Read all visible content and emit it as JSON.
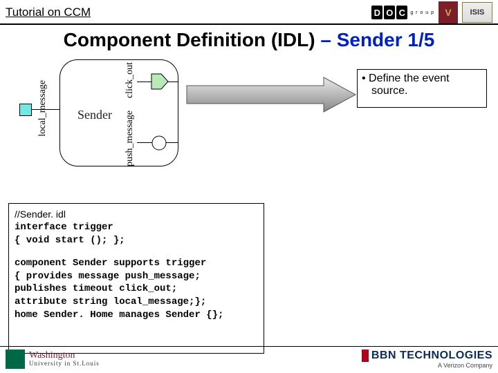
{
  "header": {
    "left": "Tutorial on CCM",
    "logo_d": "D",
    "logo_o": "O",
    "logo_c": "C",
    "logo_sub": "g r o u p",
    "isis": "ISIS"
  },
  "title": {
    "prefix": "Component Definition (IDL)",
    "suffix": " – Sender 1/5"
  },
  "diagram": {
    "component": "Sender",
    "local_message": "local_message",
    "click_out": "click_out",
    "push_message": "push_message"
  },
  "bullets": {
    "line1": "• Define the event",
    "line2": "  source."
  },
  "code": {
    "l1": "//Sender. idl",
    "l2": "interface trigger",
    "l3": "{ void start (); };",
    "l4": "component Sender supports trigger",
    "l5": "{ provides message push_message;",
    "l6": "  publishes timeout click_out;",
    "l7": "  attribute string local_message;};",
    "l8": "home Sender. Home manages Sender {};"
  },
  "footer": {
    "wustl_top": "Washington",
    "wustl_bot": "University in St.Louis",
    "bbn": "BBN TECHNOLOGIES",
    "verizon": "A Verizon Company"
  }
}
